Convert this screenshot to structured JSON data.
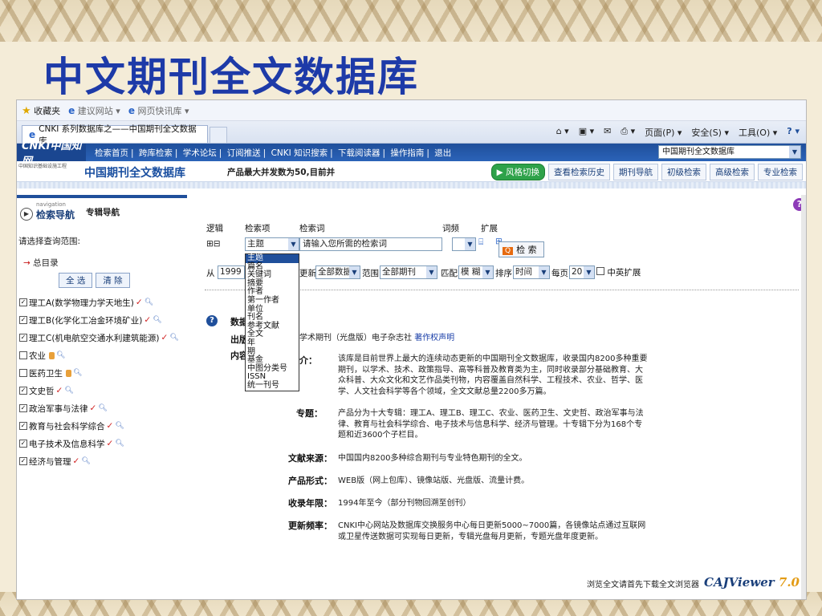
{
  "slide": {
    "title": "中文期刊全文数据库"
  },
  "favbar": {
    "favorites": "收藏夹",
    "suggested": "建议网站 ▾",
    "webslice": "网页快讯库 ▾"
  },
  "browser": {
    "tab_title": "CNKI 系列数据库之——中国期刊全文数据库",
    "commands": [
      "页面(P) ▾",
      "安全(S) ▾",
      "工具(O) ▾"
    ]
  },
  "cnki": {
    "logo": "CNKI中国知网",
    "logo_url": "www.cnki.net",
    "slogan": "中国知识基础设施工程",
    "links": [
      "检索首页",
      "跨库检索",
      "学术论坛",
      "订阅推送",
      "CNKI 知识搜索",
      "下载阅读器",
      "操作指南",
      "退出"
    ],
    "db_selected": "中国期刊全文数据库",
    "db_name": "中国期刊全文数据库",
    "notice": "产品最大并发数为50,目前并",
    "nav_buttons": [
      "风格切换",
      "查看检索历史",
      "期刊导航",
      "初级检索",
      "高级检索",
      "专业检索"
    ]
  },
  "leftnav": {
    "nav_en": "navigation",
    "nav_zh": "检索导航",
    "tab": "专辑导航",
    "hint": "请选择查询范围:",
    "root": "总目录",
    "select_all": "全 选",
    "clear": "清 除",
    "categories": [
      {
        "label": "理工A(数学物理力学天地生)",
        "checked": true,
        "locked": false
      },
      {
        "label": "理工B(化学化工冶金环境矿业)",
        "checked": true,
        "locked": false
      },
      {
        "label": "理工C(机电航空交通水利建筑能源)",
        "checked": true,
        "locked": false
      },
      {
        "label": "农业",
        "checked": false,
        "locked": true
      },
      {
        "label": "医药卫生",
        "checked": false,
        "locked": true
      },
      {
        "label": "文史哲",
        "checked": true,
        "locked": false
      },
      {
        "label": "政治军事与法律",
        "checked": true,
        "locked": false
      },
      {
        "label": "教育与社会科学综合",
        "checked": true,
        "locked": false
      },
      {
        "label": "电子技术及信息科学",
        "checked": true,
        "locked": false
      },
      {
        "label": "经济与管理",
        "checked": true,
        "locked": false
      }
    ]
  },
  "search": {
    "headers": {
      "logic": "逻辑",
      "field": "检索项",
      "term": "检索词",
      "freq": "词频",
      "expand": "扩展"
    },
    "logic_value": "⊞⊟",
    "field_value": "主题",
    "term_placeholder": "请输入您所需的检索词",
    "search_button": "检 索",
    "from_label": "从",
    "from_year": "1999",
    "update_label": "更新",
    "update_value": "全部数据",
    "scope_label": "范围",
    "scope_value": "全部期刊",
    "match_label": "匹配",
    "match_value": "模 糊",
    "sort_label": "排序",
    "sort_value": "时间",
    "per_page_label": "每页",
    "per_page_value": "20",
    "cn_en_expand": "中英扩展",
    "field_options": [
      "主题",
      "篇名",
      "关键词",
      "摘要",
      "作者",
      "第一作者",
      "单位",
      "刊名",
      "参考文献",
      "全文",
      "年",
      "期",
      "基金",
      "中图分类号",
      "ISSN",
      "统一刊号"
    ]
  },
  "intro": {
    "title": "数据库",
    "publisher_label": "出版",
    "publisher_text": "学术期刊（光盘版）电子杂志社",
    "copyright_link": "著作权声明",
    "content_label": "内容",
    "sections": [
      {
        "label": "介：",
        "text": "该库是目前世界上最大的连续动态更新的中国期刊全文数据库，收录国内8200多种重要期刊，以学术、技术、政策指导、高等科普及教育类为主，同时收录部分基础教育、大众科普、大众文化和文艺作品类刊物，内容覆盖自然科学、工程技术、农业、哲学、医学、人文社会科学等各个领域，全文文献总量2200多万篇。"
      },
      {
        "label": "专题：",
        "text": "产品分为十大专辑：理工A、理工B、理工C、农业、医药卫生、文史哲、政治军事与法律、教育与社会科学综合、电子技术与信息科学、经济与管理。十专辑下分为168个专题和近3600个子栏目。"
      },
      {
        "label": "文献来源：",
        "text": "中国国内8200多种综合期刊与专业特色期刊的全文。"
      },
      {
        "label": "产品形式：",
        "text": "WEB版（网上包库）、镜像站版、光盘版、流量计费。"
      },
      {
        "label": "收录年限：",
        "text": "1994年至今（部分刊物回溯至创刊）"
      },
      {
        "label": "更新频率：",
        "text": "CNKI中心网站及数据库交换服务中心每日更新5000~7000篇，各镜像站点通过互联网或卫星传送数据可实现每日更新，专辑光盘每月更新，专题光盘年度更新。"
      }
    ]
  },
  "footer": {
    "note": "浏览全文请首先下载全文浏览器",
    "viewer_logo": "CAJViewer",
    "viewer_version": "7.0"
  },
  "colors": {
    "title": "#1d3aa8",
    "cnki_blue": "#1f4f9b",
    "accent": "#e39b14"
  }
}
